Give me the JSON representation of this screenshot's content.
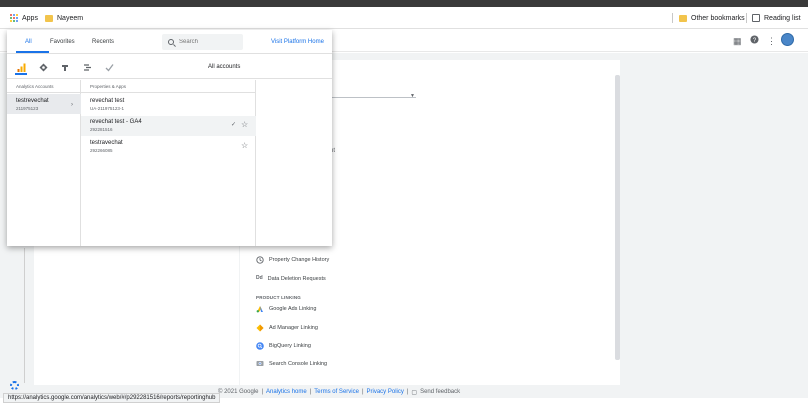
{
  "browser": {
    "bookmarks": {
      "apps_label": "Apps",
      "folder_label": "Nayeem",
      "other_label": "Other bookmarks",
      "reading_label": "Reading list"
    },
    "status_url": "https://analytics.google.com/analytics/web/#/p292281516/reports/reportinghub"
  },
  "popup": {
    "tabs": [
      "All",
      "Favorites",
      "Recents"
    ],
    "search_placeholder": "Search",
    "platform_link": "Visit Platform Home",
    "all_accounts": "All accounts",
    "products": [
      "analytics-icon",
      "tag-manager-icon",
      "optimize-icon",
      "data-studio-icon",
      "surveys-icon"
    ],
    "accounts_header": "Analytics Accounts",
    "properties_header": "Properties & Apps",
    "account": {
      "name": "testrevechat",
      "id": "211975123"
    },
    "properties": [
      {
        "name": "revechat test",
        "id": "UA-211975123-1"
      },
      {
        "name": "revechat test - GA4",
        "id": "292281516"
      },
      {
        "name": "testravechat",
        "id": "292266085"
      }
    ]
  },
  "admin": {
    "fragment": "nt",
    "items_top": [
      {
        "label": "Property Change History",
        "icon": "history-icon"
      },
      {
        "label": "Data Deletion Requests",
        "icon": "dd-icon"
      }
    ],
    "section_label": "PRODUCT LINKING",
    "links": [
      {
        "label": "Google Ads Linking",
        "icon": "google-ads-icon"
      },
      {
        "label": "Ad Manager Linking",
        "icon": "ad-manager-icon"
      },
      {
        "label": "BigQuery Linking",
        "icon": "bigquery-icon"
      },
      {
        "label": "Search Console Linking",
        "icon": "search-console-icon"
      }
    ]
  },
  "footer": {
    "copyright": "© 2021 Google",
    "sep": "|",
    "home": "Analytics home",
    "terms": "Terms of Service",
    "privacy": "Privacy Policy",
    "feedback": "Send feedback"
  },
  "colors": {
    "accent": "#1a73e8",
    "folder": "#f2c44c",
    "analytics_orange": "#f9ab00"
  }
}
